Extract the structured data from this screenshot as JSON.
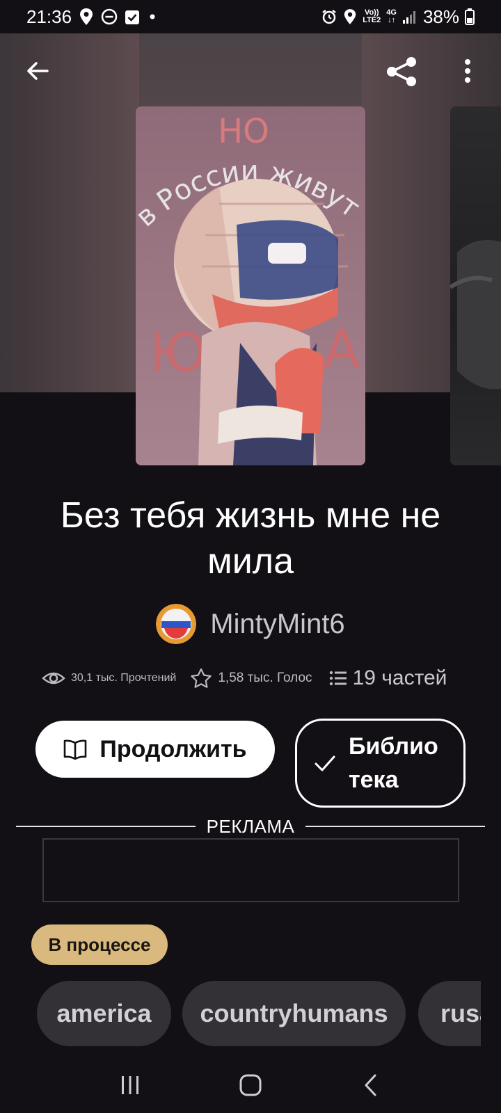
{
  "status_bar": {
    "time": "21:36",
    "network_top": "Vo))",
    "network_bottom": "LTE2",
    "network_type": "4G",
    "battery": "38%",
    "icons": [
      "location-icon",
      "dnd-icon",
      "check-square-icon",
      "dot-icon",
      "alarm-icon",
      "location-icon",
      "signal-icon",
      "battery-icon"
    ]
  },
  "top_nav": {
    "back_icon": "arrow-left-icon",
    "share_icon": "share-icon",
    "menu_icon": "more-vertical-icon"
  },
  "cover": {
    "art_text_top": "НО",
    "art_text_arc": "в России живут",
    "art_text_left": "Ю",
    "art_text_right": "А"
  },
  "story": {
    "title": "Без тебя жизнь мне не мила",
    "author": "MintyMint6"
  },
  "stats": {
    "reads": "30,1 тыс. Прочтений",
    "votes": "1,58 тыс. Голос",
    "parts": "19 частей"
  },
  "actions": {
    "continue_label": "Продолжить",
    "library_label": "Библио тека"
  },
  "ad": {
    "label": "РЕКЛАМА"
  },
  "story_status": "В процессе",
  "tags": [
    "america",
    "countryhumans",
    "rusa"
  ],
  "colors": {
    "background": "#121014",
    "status_pill": "#d9b97d",
    "tag_bg": "#333136",
    "button_bg": "#ffffff"
  },
  "system_nav": {
    "recent_icon": "recent-apps-icon",
    "home_icon": "home-icon",
    "back_icon": "back-chevron-icon"
  }
}
